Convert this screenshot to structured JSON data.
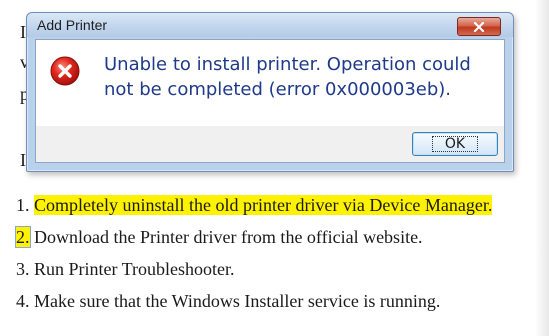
{
  "dialog": {
    "title": "Add Printer",
    "message": "Unable to install printer. Operation could not be completed (error 0x000003eb).",
    "ok_label": "OK",
    "icons": {
      "error": "error-circle-icon",
      "close": "close-icon"
    },
    "colors": {
      "message_text": "#1f3a8a",
      "titlebar": "#c4d8ee",
      "close_button": "#c0391f",
      "error_icon": "#d2201a"
    }
  },
  "steps": [
    {
      "num": "1.",
      "text": "Completely uninstall the old printer driver via Device Manager."
    },
    {
      "num": "2.",
      "text": "Download the Printer driver from the official website."
    },
    {
      "num": "3.",
      "text": "Run Printer Troubleshooter."
    },
    {
      "num": "4.",
      "text": "Make sure that the Windows Installer service is running."
    }
  ],
  "colors": {
    "highlight": "#fff200"
  }
}
